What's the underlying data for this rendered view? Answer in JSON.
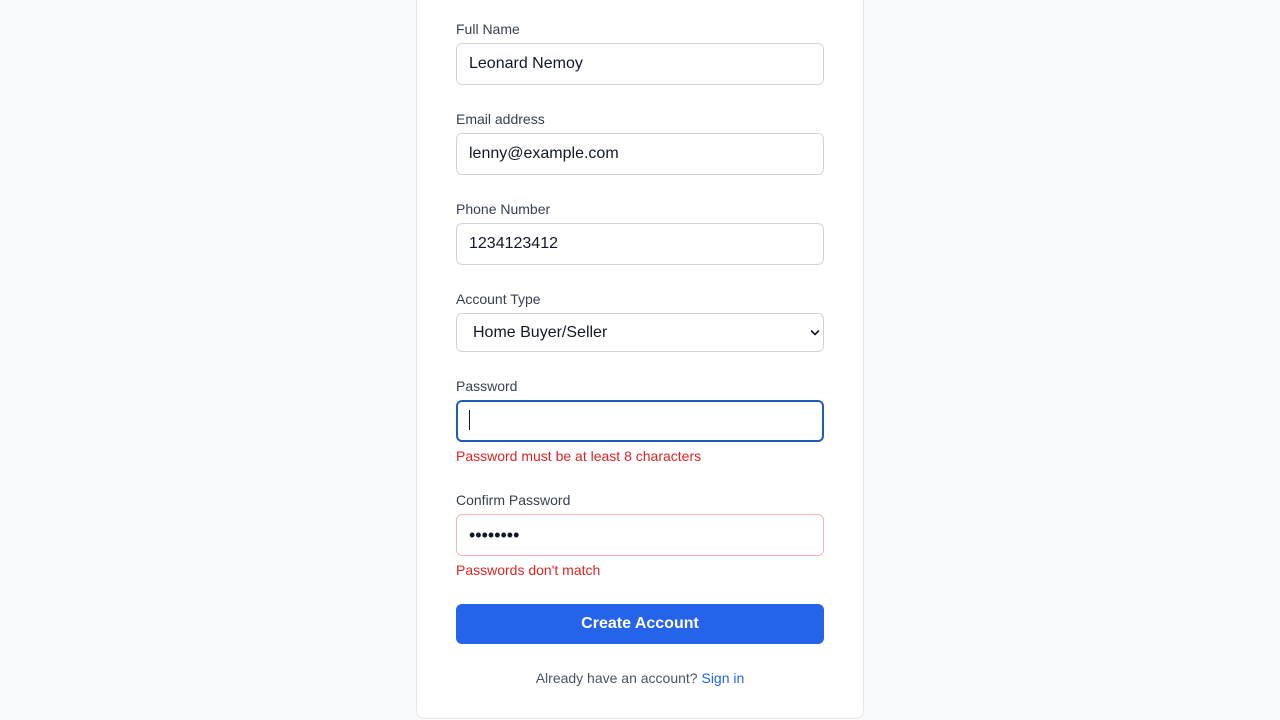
{
  "form": {
    "full_name": {
      "label": "Full Name",
      "value": "Leonard Nemoy"
    },
    "email": {
      "label": "Email address",
      "value": "lenny@example.com"
    },
    "phone": {
      "label": "Phone Number",
      "value": "1234123412"
    },
    "account_type": {
      "label": "Account Type",
      "selected": "Home Buyer/Seller"
    },
    "password": {
      "label": "Password",
      "value": "",
      "error": "Password must be at least 8 characters"
    },
    "confirm_password": {
      "label": "Confirm Password",
      "value": "••••••••",
      "error": "Passwords don't match"
    },
    "submit_label": "Create Account"
  },
  "footer": {
    "prompt": "Already have an account?",
    "link_label": "Sign in"
  },
  "colors": {
    "primary": "#2563eb",
    "error": "#dc2626",
    "focus_border": "#1d5fb8",
    "error_border": "#f5b5b5"
  }
}
